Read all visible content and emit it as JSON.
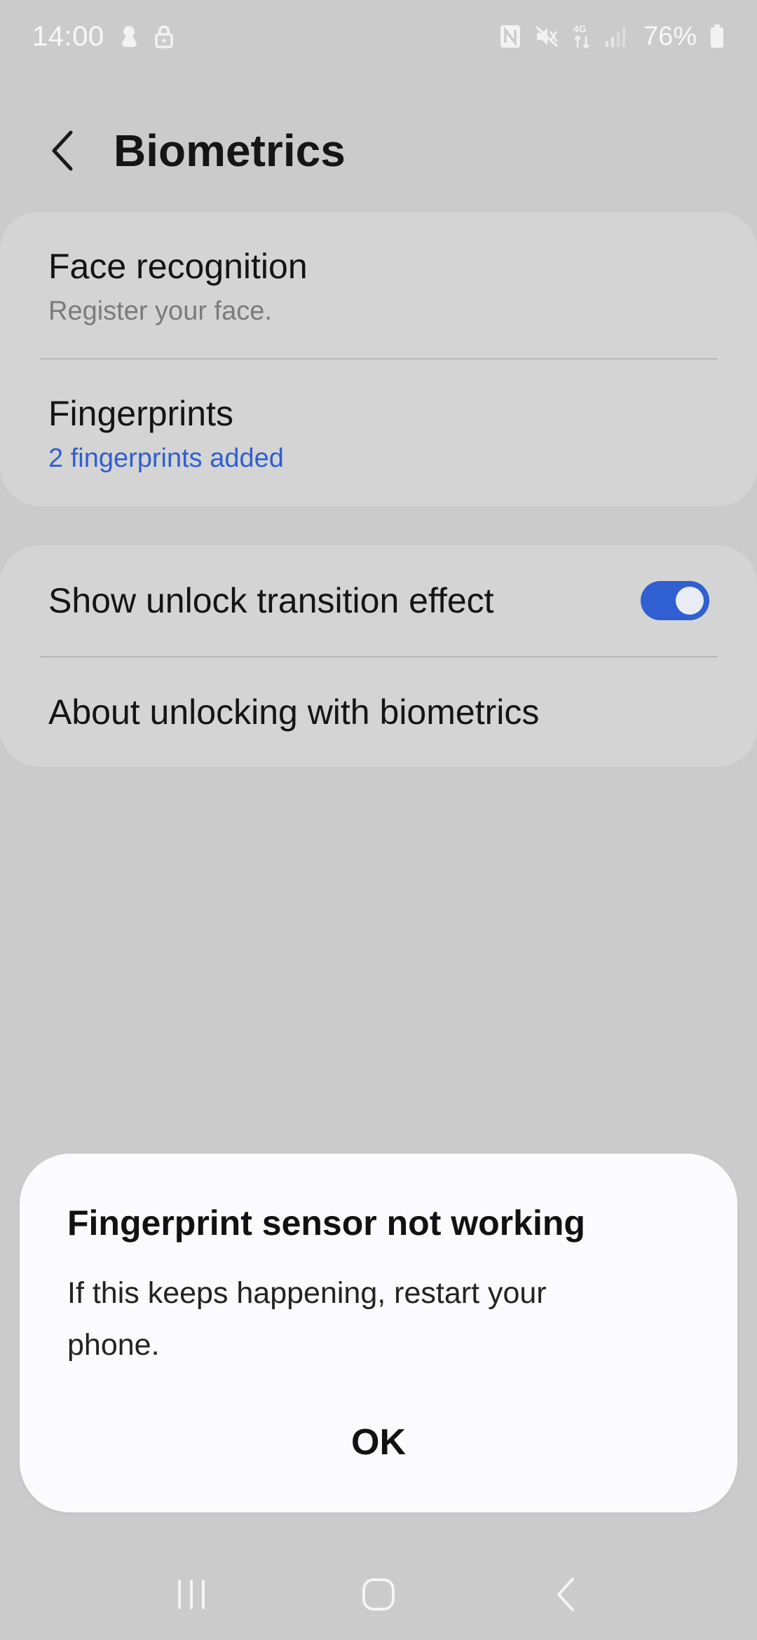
{
  "status_bar": {
    "time": "14:00",
    "battery": "76%",
    "icons": [
      "hands-notification-icon",
      "lock-icon",
      "nfc-icon",
      "mute-icon",
      "4g-icon",
      "signal-icon",
      "battery-icon"
    ]
  },
  "header": {
    "title": "Biometrics",
    "back_icon": "back-chevron-icon"
  },
  "biometrics_card": {
    "items": [
      {
        "title": "Face recognition",
        "subtitle": "Register your face."
      },
      {
        "title": "Fingerprints",
        "subtitle": "2 fingerprints added"
      }
    ]
  },
  "settings_card": {
    "items": [
      {
        "title": "Show unlock transition effect",
        "toggle_on": true
      },
      {
        "title": "About unlocking with biometrics"
      }
    ]
  },
  "dialog": {
    "title": "Fingerprint sensor not working",
    "message": "If this keeps happening, restart your phone.",
    "ok_label": "OK"
  },
  "nav_bar": {
    "buttons": [
      "recent-apps-icon",
      "home-icon",
      "back-icon"
    ]
  },
  "colors": {
    "background": "#cbcbcb",
    "card": "#d4d4d4",
    "accent": "#2f5fd0",
    "dialog": "#fbfbfd"
  }
}
